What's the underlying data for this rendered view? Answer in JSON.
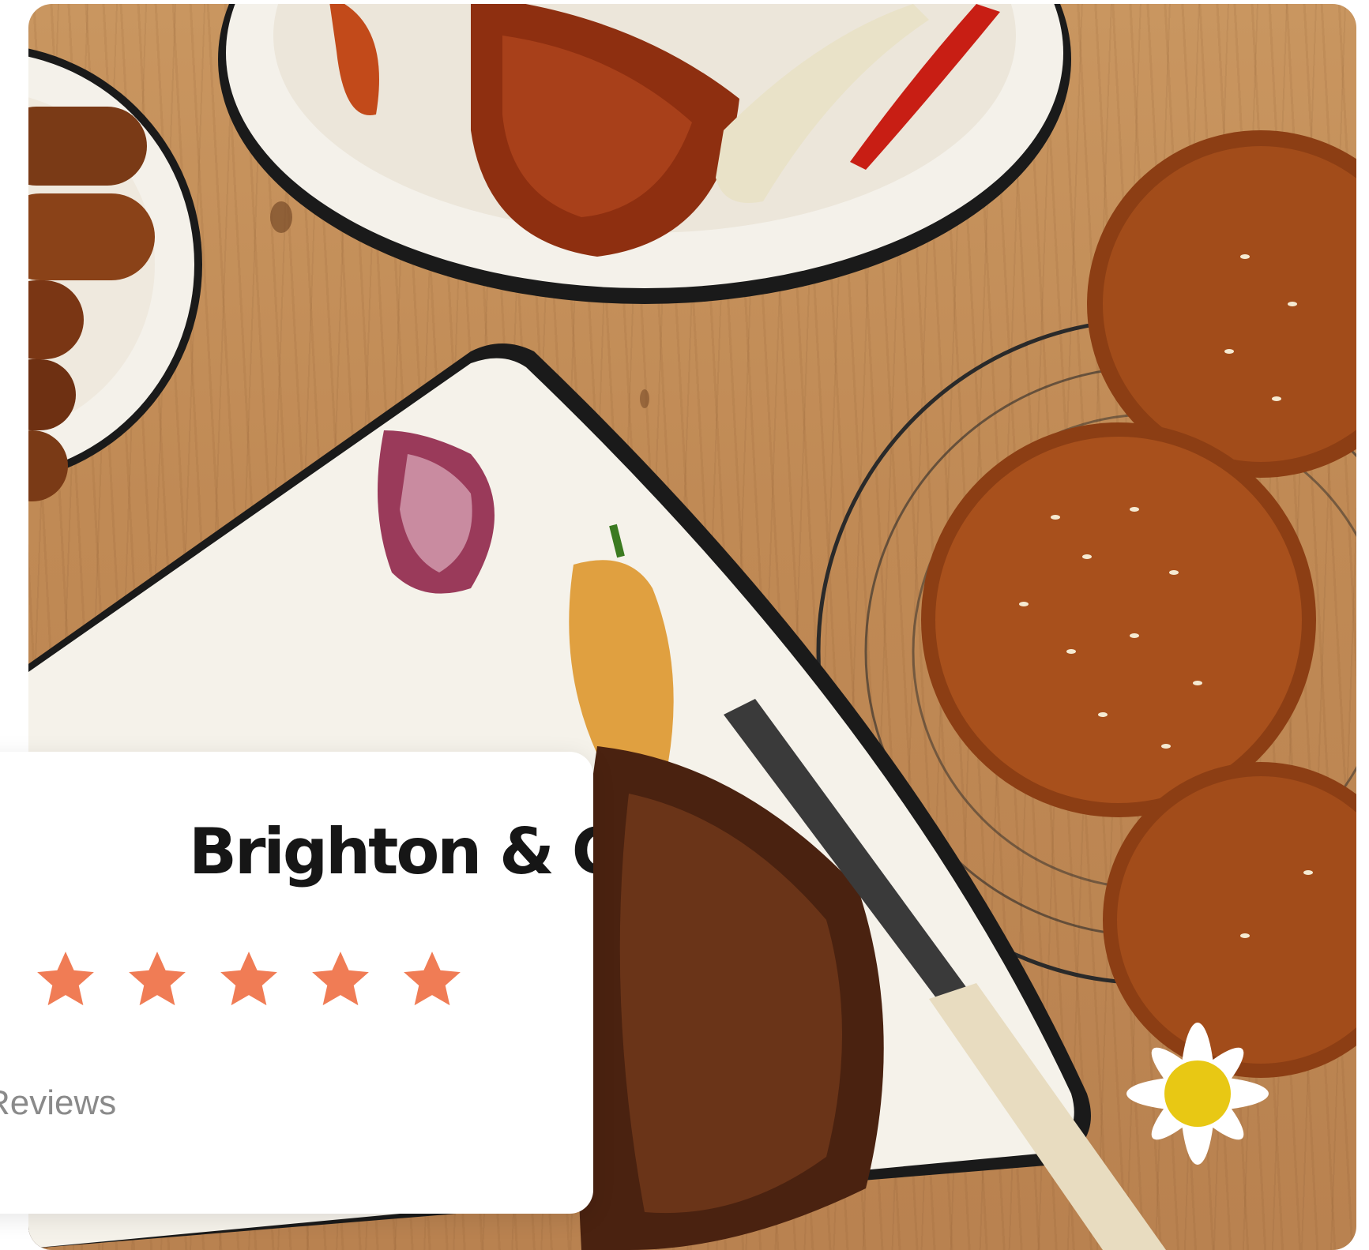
{
  "card": {
    "title": "Brighton & Co.",
    "rating": 5,
    "rating_max": 5,
    "reviews_text": "Reviews",
    "star_color": "#f07c55"
  },
  "photo": {
    "icon": "food-photo"
  }
}
